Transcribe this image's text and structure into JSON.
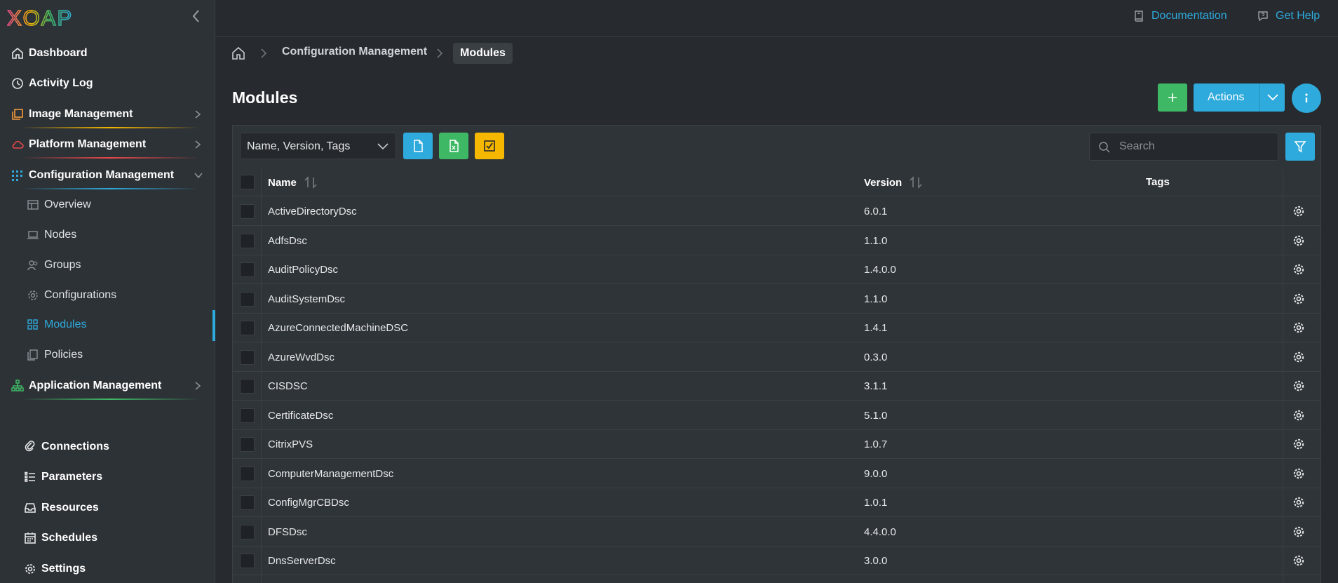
{
  "app": {
    "logo_text": "XOAP",
    "colors": {
      "accent": "#2eaadc",
      "green": "#3fb866",
      "yellow": "#f5b700"
    }
  },
  "sidebar": {
    "main_items": [
      {
        "label": "Dashboard",
        "icon": "home-icon"
      },
      {
        "label": "Activity Log",
        "icon": "clock-icon"
      },
      {
        "label": "Image Management",
        "icon": "layers-icon"
      },
      {
        "label": "Platform Management",
        "icon": "cloud-icon"
      },
      {
        "label": "Configuration Management",
        "icon": "grid-icon"
      }
    ],
    "sub_items": [
      {
        "label": "Overview",
        "icon": "dashboard-icon"
      },
      {
        "label": "Nodes",
        "icon": "laptop-icon"
      },
      {
        "label": "Groups",
        "icon": "users-icon"
      },
      {
        "label": "Configurations",
        "icon": "gear-icon"
      },
      {
        "label": "Modules",
        "icon": "modules-icon",
        "active": true
      },
      {
        "label": "Policies",
        "icon": "policies-icon"
      }
    ],
    "app_item": {
      "label": "Application Management",
      "icon": "sitemap-icon"
    },
    "bottom_items": [
      {
        "label": "Connections",
        "icon": "link-icon"
      },
      {
        "label": "Parameters",
        "icon": "list-icon"
      },
      {
        "label": "Resources",
        "icon": "inbox-icon"
      },
      {
        "label": "Schedules",
        "icon": "calendar-icon"
      },
      {
        "label": "Settings",
        "icon": "gear-icon"
      }
    ]
  },
  "topbar": {
    "documentation": "Documentation",
    "help": "Get Help"
  },
  "breadcrumb": {
    "items": [
      "Configuration Management"
    ],
    "current": "Modules"
  },
  "page": {
    "title": "Modules",
    "actions_label": "Actions"
  },
  "toolbar": {
    "columns_select": "Name, Version, Tags",
    "search_placeholder": "Search"
  },
  "table": {
    "headers": {
      "name": "Name",
      "version": "Version",
      "tags": "Tags"
    },
    "rows": [
      {
        "name": "ActiveDirectoryDsc",
        "version": "6.0.1",
        "tags": ""
      },
      {
        "name": "AdfsDsc",
        "version": "1.1.0",
        "tags": ""
      },
      {
        "name": "AuditPolicyDsc",
        "version": "1.4.0.0",
        "tags": ""
      },
      {
        "name": "AuditSystemDsc",
        "version": "1.1.0",
        "tags": ""
      },
      {
        "name": "AzureConnectedMachineDSC",
        "version": "1.4.1",
        "tags": ""
      },
      {
        "name": "AzureWvdDsc",
        "version": "0.3.0",
        "tags": ""
      },
      {
        "name": "CISDSC",
        "version": "3.1.1",
        "tags": ""
      },
      {
        "name": "CertificateDsc",
        "version": "5.1.0",
        "tags": ""
      },
      {
        "name": "CitrixPVS",
        "version": "1.0.7",
        "tags": ""
      },
      {
        "name": "ComputerManagementDsc",
        "version": "9.0.0",
        "tags": ""
      },
      {
        "name": "ConfigMgrCBDsc",
        "version": "1.0.1",
        "tags": ""
      },
      {
        "name": "DFSDsc",
        "version": "4.4.0.0",
        "tags": ""
      },
      {
        "name": "DnsServerDsc",
        "version": "3.0.0",
        "tags": ""
      }
    ]
  }
}
